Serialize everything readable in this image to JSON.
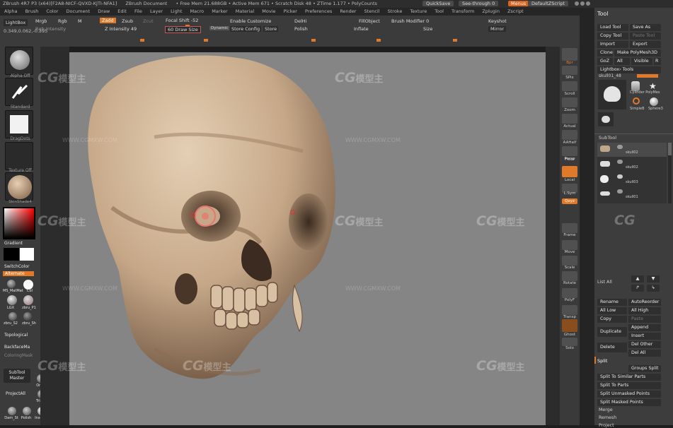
{
  "title_bar": {
    "items": [
      "ZBrush 4R7 P3 (x64)[F2A8-NICF-QVXD-KJTI-NFA1]",
      "ZBrush Document",
      "• Free Mem 21.688GB • Active Mem 671 • Scratch Disk 48 • ZTime 1.177 • PolyCounts"
    ],
    "quicksave": "QuickSave",
    "see_through": "See-through  0",
    "menus": "Menus",
    "default_script": "DefaultZScript"
  },
  "menu_bar": [
    "Alpha",
    "Brush",
    "Color",
    "Document",
    "Draw",
    "Edit",
    "File",
    "Layer",
    "Light",
    "Macro",
    "Marker",
    "Material",
    "Movie",
    "Picker",
    "Preferences",
    "Render",
    "Stencil",
    "Stroke",
    "Texture",
    "Tool",
    "Transform",
    "Zplugin",
    "Zscript"
  ],
  "top_shelf": {
    "lightbox": "LightBox",
    "coords": "0.349,0.062,-0.395",
    "mrgb": "Mrgb",
    "rgb": "Rgb",
    "m": "M",
    "zadd": "Zadd",
    "zsub": "Zsub",
    "zcut": "Zcut",
    "focal_shift": "Focal Shift -52",
    "z_intensity": "Z Intensity 49",
    "rgb_intensity": "Rgb Intensity",
    "draw_size": "60  Draw Size",
    "dynamic": "Dynamic",
    "enable_customize": "Enable Customize",
    "store_config": "Store Config",
    "store": "Store",
    "delhi": "DelHi",
    "polish": "Polish",
    "fill_object": "FillObject",
    "inflate": "Inflate",
    "brush_modifier": "Brush Modifier 0",
    "size": "Size",
    "keyshot": "Keyshot",
    "mirror": "Mirror"
  },
  "left_panel": {
    "alpha_label": "Alpha Off",
    "brush_label": "Standard",
    "stroke_label": "DragDots",
    "texture_label": "Texture Off",
    "material_label": "SkinShade4",
    "gradient": "Gradient",
    "switch_color": "SwitchColor",
    "alternate": "Alternate",
    "mat_labels": [
      "MS_MatMat",
      "Col",
      "LGX",
      "zbru_P1",
      "zbru_S2",
      "zbru_Sh"
    ],
    "topological": "Topological",
    "backface": "BackfaceMa",
    "coloring": "ColoringMask",
    "subtool_master": "SubTool Master",
    "project_all": "ProjectAll",
    "bottom_labels": [
      "Orb_Po",
      "Trimdyn",
      "Dam_St",
      "Polish",
      "InsertC"
    ]
  },
  "right_shelf": [
    "Bpr",
    "SPix",
    "Scroll",
    "Zoom",
    "Actual",
    "AAHalf",
    "Persp",
    "Floor",
    "Local",
    "L.Sym",
    "Qxyz",
    "Frame",
    "Move",
    "Scale",
    "Rotate",
    "PolyF",
    "Transp",
    "Ghost",
    "Solo"
  ],
  "tool_panel": {
    "title": "Tool",
    "buttons": [
      "Load Tool",
      "Save As",
      "Copy Tool",
      "Paste Tool",
      "Import",
      "Export",
      "Clone",
      "Make PolyMesh3D",
      "GoZ",
      "All",
      "Visible",
      "R"
    ],
    "lightbox_tools": "Lightbox› Tools",
    "current_tool": "skull01_48",
    "tool_thumbs": [
      "skull01_4",
      "Cylinder PolyMes",
      "SimpleB",
      "Sphere3"
    ],
    "subtool_header": "SubTool",
    "subtools": [
      "skull02",
      "skull02",
      "skull03",
      "skull01"
    ],
    "list_all": "List All",
    "rename": "Rename",
    "auto_reorder": "AutoReorder",
    "all_low": "All Low",
    "all_high": "All High",
    "copy": "Copy",
    "paste": "Paste",
    "append": "Append",
    "duplicate": "Duplicate",
    "insert": "Insert",
    "del_other": "Del Other",
    "delete": "Delete",
    "del_all": "Del All",
    "split_header": "Split",
    "split_groups": "Groups Split",
    "split_similar": "Split To Similar Parts",
    "split_parts": "Split To Parts",
    "split_unmasked": "Split Unmasked Points",
    "split_masked": "Split Masked Points",
    "merge": "Merge",
    "remesh": "Remesh",
    "project": "Project"
  },
  "watermark": {
    "logo": "CG",
    "cn": "模型主",
    "url": "WWW.CGMXW.COM"
  },
  "colors": {
    "accent": "#e07a2a",
    "panel": "#3b3b3b",
    "canvas": "#858585",
    "skull": "#c9ad8d"
  }
}
